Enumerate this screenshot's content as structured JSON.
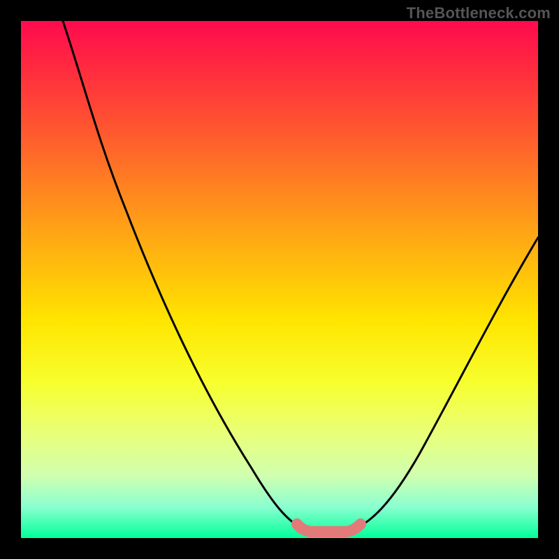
{
  "watermark": "TheBottleneck.com",
  "colors": {
    "frame": "#000000",
    "curve": "#000000",
    "highlight": "#e27a7a",
    "gradient_stops": [
      "#ff0a4f",
      "#ff2e3e",
      "#ff5a2e",
      "#ff8a1e",
      "#ffb80e",
      "#ffe500",
      "#f7ff2e",
      "#e8ff7a",
      "#d0ffb0",
      "#8affd0",
      "#00ff99"
    ]
  },
  "chart_data": {
    "type": "line",
    "title": "",
    "xlabel": "",
    "ylabel": "",
    "xlim": [
      0,
      100
    ],
    "ylim": [
      0,
      100
    ],
    "series": [
      {
        "name": "bottleneck-curve",
        "x": [
          0,
          6,
          12,
          18,
          24,
          30,
          36,
          42,
          48,
          52,
          56,
          60,
          64,
          70,
          76,
          82,
          88,
          94,
          100
        ],
        "y": [
          100,
          87,
          74,
          61,
          48,
          36,
          26,
          17,
          9,
          4,
          1,
          0,
          1,
          5,
          13,
          23,
          34,
          46,
          58
        ]
      }
    ],
    "highlight": {
      "name": "optimal-range",
      "x": [
        52,
        56,
        60,
        64
      ],
      "y": [
        4,
        1,
        0,
        1
      ]
    }
  }
}
